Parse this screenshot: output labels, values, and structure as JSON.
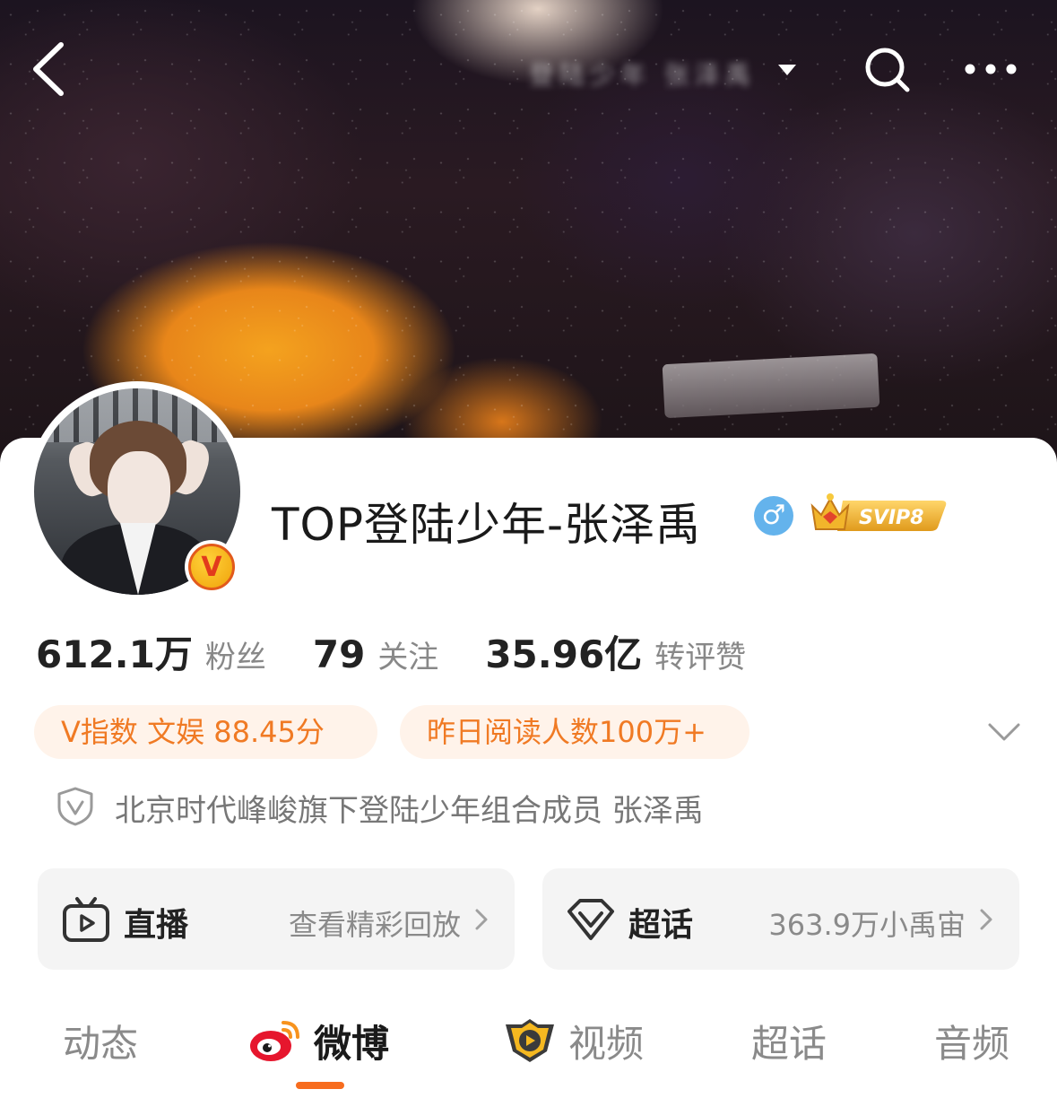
{
  "nav": {
    "title": "登陆少年 张泽禹"
  },
  "profile": {
    "name": "TOP登陆少年-张泽禹",
    "gender_symbol": "♂",
    "svip_label": "SVIP8",
    "verified_badge": "V"
  },
  "stats": [
    {
      "value": "612.1万",
      "label": "粉丝"
    },
    {
      "value": "79",
      "label": "关注"
    },
    {
      "value": "35.96亿",
      "label": "转评赞"
    }
  ],
  "tags": [
    {
      "label": "V指数 文娱 88.45分"
    },
    {
      "label": "昨日阅读人数100万+"
    }
  ],
  "verification": {
    "text": "北京时代峰峻旗下登陆少年组合成员 张泽禹"
  },
  "feature_cards": [
    {
      "title": "直播",
      "subtitle": "查看精彩回放",
      "icon": "tv-icon"
    },
    {
      "title": "超话",
      "subtitle": "363.9万小禹宙",
      "icon": "diamond-icon"
    }
  ],
  "tabs": [
    {
      "label": "动态",
      "active": false
    },
    {
      "label": "微博",
      "active": true,
      "icon": "weibo-logo-icon"
    },
    {
      "label": "视频",
      "active": false,
      "icon": "video-play-icon"
    },
    {
      "label": "超话",
      "active": false
    },
    {
      "label": "音频",
      "active": false
    }
  ],
  "colors": {
    "accent": "#f76c1e",
    "tag_text": "#f07a24",
    "tag_bg": "#fff3ea",
    "gender_blue": "#64b3ec",
    "svip_gold": "#e8a522"
  }
}
